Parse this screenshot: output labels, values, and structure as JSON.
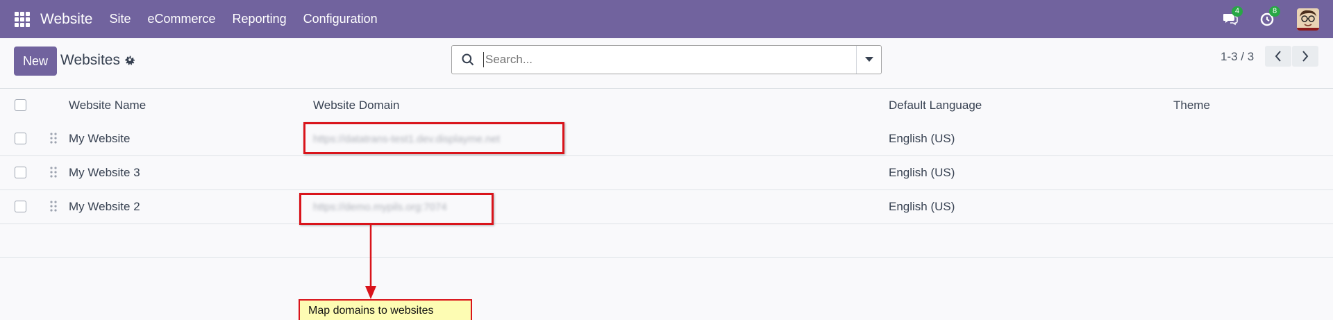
{
  "navbar": {
    "app_name": "Website",
    "menu": [
      "Site",
      "eCommerce",
      "Reporting",
      "Configuration"
    ],
    "messages_count": "4",
    "activities_count": "8",
    "background_color": "#71639e"
  },
  "control_panel": {
    "new_label": "New",
    "title": "Websites",
    "search_placeholder": "Search...",
    "pager": "1-3 / 3"
  },
  "table": {
    "columns": [
      "Website Name",
      "Website Domain",
      "Default Language",
      "Theme"
    ],
    "rows": [
      {
        "name": "My Website",
        "domain": "https://datatrans-test1.dev.displayme.net",
        "language": "English (US)",
        "theme": ""
      },
      {
        "name": "My Website 3",
        "domain": "",
        "language": "English (US)",
        "theme": ""
      },
      {
        "name": "My Website 2",
        "domain": "https://demo.mypils.org:7074",
        "language": "English (US)",
        "theme": ""
      }
    ]
  },
  "annotation": {
    "text": "Map domains to websites",
    "color": "#d9141b"
  }
}
